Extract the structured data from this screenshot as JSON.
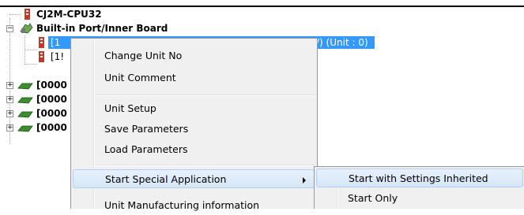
{
  "tree": {
    "root_label": "CJ2M-CPU32",
    "port_label": "Built-in Port/Inner Board",
    "selected_item_label": "[1",
    "selected_item_suffix": "/) (Unit : 0)",
    "second_item_label": "[1!",
    "units": [
      "[0000",
      "[0000",
      "[0000",
      "[0000"
    ]
  },
  "context_menu": {
    "items": [
      {
        "label": "Change Unit No"
      },
      {
        "label": "Unit Comment"
      },
      {
        "label": "Unit Setup"
      },
      {
        "label": "Save Parameters"
      },
      {
        "label": "Load Parameters"
      },
      {
        "label": "Start Special Application"
      },
      {
        "label": "Unit Manufacturing information"
      }
    ]
  },
  "submenu": {
    "items": [
      {
        "label": "Start with Settings Inherited"
      },
      {
        "label": "Start Only"
      }
    ]
  },
  "colors": {
    "selection": "#3399ff",
    "menu_bg": "#f0f0f0",
    "highlight": "#d5e6f8",
    "unit_icon": "#3c8d2e",
    "plc_icon": "#c0392b"
  }
}
